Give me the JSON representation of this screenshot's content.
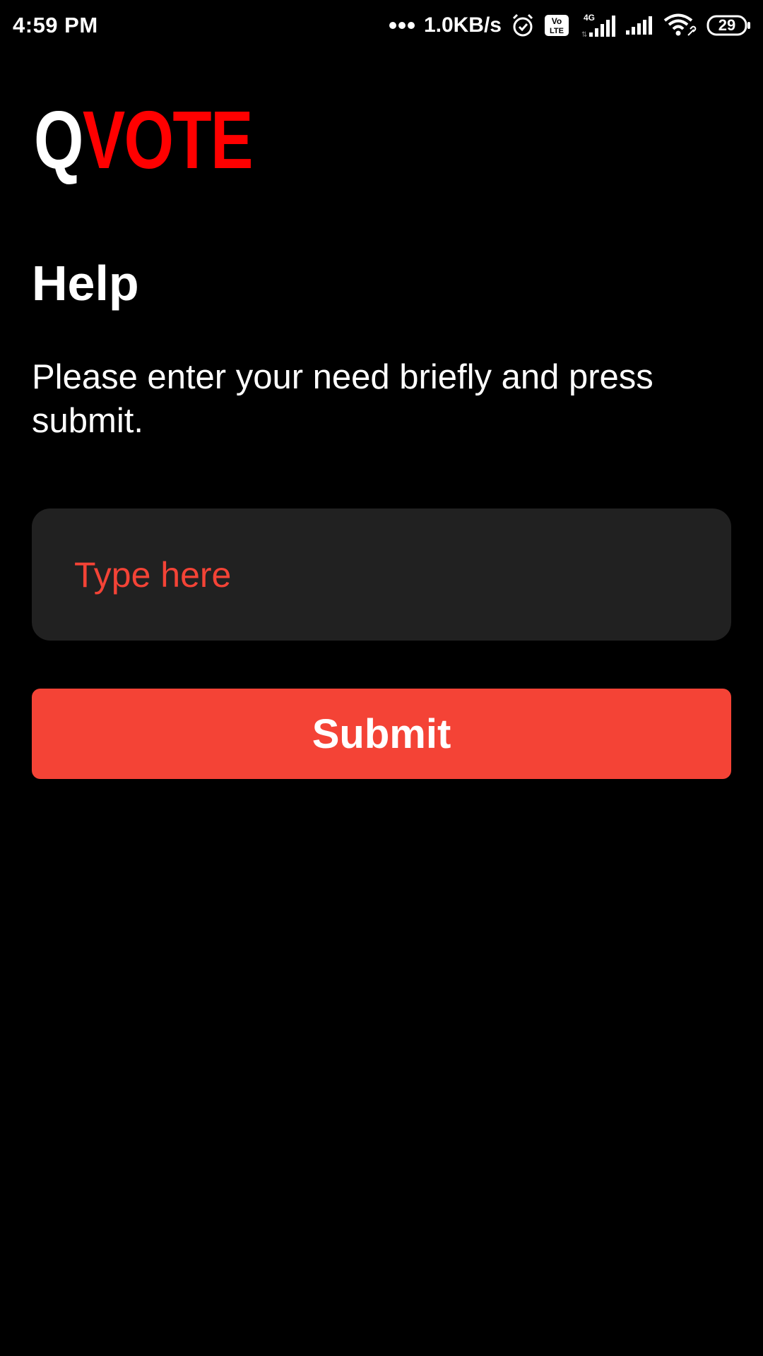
{
  "status_bar": {
    "time": "4:59 PM",
    "network_speed": "1.0KB/s",
    "network_type": "4G",
    "volte_label": "Vo LTE",
    "battery_level": "29",
    "icons": [
      "more-dots-icon",
      "alarm-icon",
      "volte-icon",
      "signal-4g-icon",
      "signal-icon",
      "wifi-icon",
      "battery-icon"
    ]
  },
  "logo": {
    "first": "Q",
    "rest": "VOTE"
  },
  "page": {
    "title": "Help",
    "instructions": "Please enter your need briefly and press submit."
  },
  "help_form": {
    "input_placeholder": "Type here",
    "input_value": "",
    "submit_label": "Submit"
  },
  "colors": {
    "background": "#000000",
    "accent": "#f44336",
    "logo_red": "#ff0000",
    "input_background": "#212121",
    "text": "#ffffff"
  }
}
